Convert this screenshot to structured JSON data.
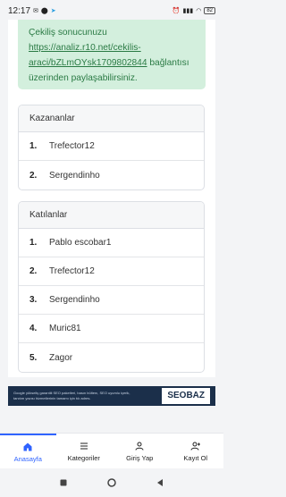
{
  "status_bar": {
    "time": "12:17",
    "battery": "82"
  },
  "alert": {
    "text_prefix": "Çekiliş sonucunuzu",
    "link": "https://analiz.r10.net/cekilis-araci/bZLmOYsk1709802844",
    "text_suffix": " bağlantısı üzerinden paylaşabilirsiniz."
  },
  "winners": {
    "title": "Kazananlar",
    "items": [
      {
        "rank": "1.",
        "name": "Trefector12"
      },
      {
        "rank": "2.",
        "name": "Sergendinho"
      }
    ]
  },
  "participants": {
    "title": "Katılanlar",
    "items": [
      {
        "rank": "1.",
        "name": "Pablo escobar1"
      },
      {
        "rank": "2.",
        "name": "Trefector12"
      },
      {
        "rank": "3.",
        "name": "Sergendinho"
      },
      {
        "rank": "4.",
        "name": "Muric81"
      },
      {
        "rank": "5.",
        "name": "Zagor"
      }
    ]
  },
  "ad": {
    "text": "Google yükseliş garantili SEO paketleri, basın bültenı, SEO uyumlu içerik, tanıtım yazısı hizmetlerinin tamamı için tık adres.",
    "logo": "SEOBAZ"
  },
  "bottom_nav": {
    "home": "Anasayfa",
    "categories": "Kategoriler",
    "login": "Giriş Yap",
    "register": "Kayıt Ol"
  },
  "colors": {
    "accent": "#2f63ff",
    "alert_bg": "#d3efdd",
    "alert_text": "#2a7a44"
  }
}
